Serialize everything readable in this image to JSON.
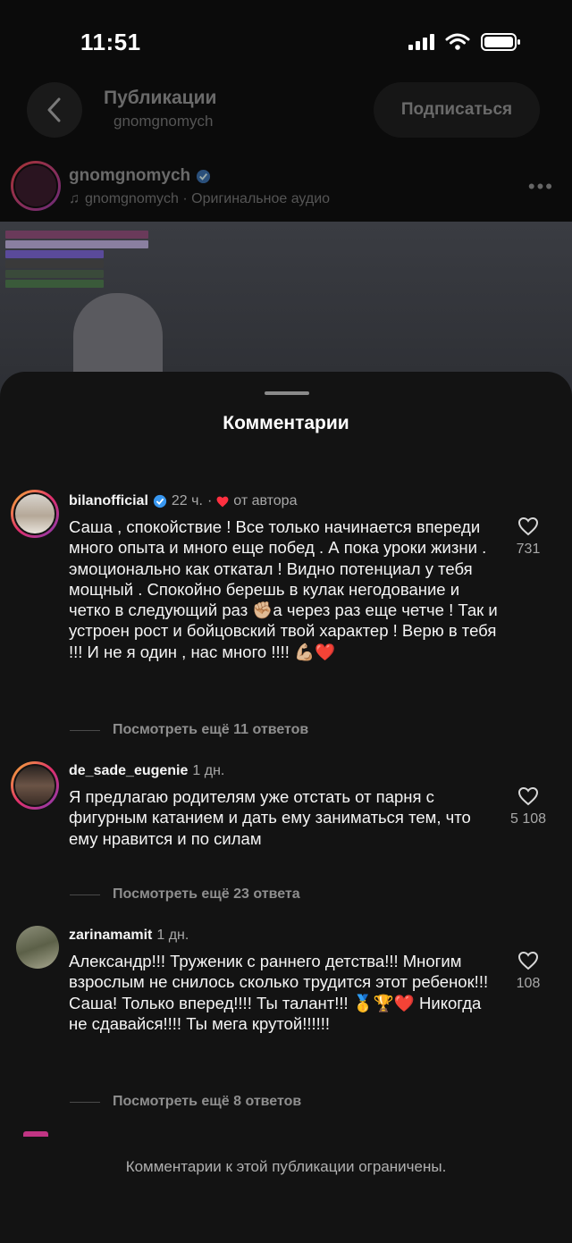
{
  "status_bar": {
    "time": "11:51"
  },
  "header": {
    "title": "Публикации",
    "subtitle": "gnomgnomych",
    "subscribe_label": "Подписаться"
  },
  "post": {
    "username": "gnomgnomych",
    "audio": "gnomgnomych · Оригинальное аудио"
  },
  "sheet": {
    "title": "Комментарии",
    "comments": [
      {
        "username": "bilanofficial",
        "time": "22 ч.",
        "author_like": "от автора",
        "text": "Саша , спокойствие ! Все только начинается впереди много опыта и много еще побед . А пока уроки  жизни . эмоционально как откатал ! Видно потенциал у тебя мощный . Спокойно берешь в кулак негодование и четко в следующий раз ✊🏼а через раз еще четче ! Так и устроен  рост и бойцовский твой характер ! Верю в тебя !!! И не я один , нас много !!!! 💪🏼❤️",
        "likes": "731",
        "replies": "Посмотреть ещё 11 ответов"
      },
      {
        "username": "de_sade_eugenie",
        "time": "1 дн.",
        "text": "Я предлагаю родителям уже отстать от парня с фигурным катанием и дать ему заниматься тем, что ему нравится и по силам",
        "likes": "5 108",
        "replies": "Посмотреть ещё 23 ответа"
      },
      {
        "username": "zarinamamit",
        "time": "1 дн.",
        "text": "Александр!!! Труженик с раннего детства!!! Многим взрослым не снилось сколько трудится этот ребенок!!! Саша! Только вперед!!!! Ты талант!!! 🥇🏆❤️ Никогда не сдавайся!!!! Ты мега крутой!!!!!!",
        "likes": "108",
        "replies": "Посмотреть ещё 8 ответов"
      }
    ],
    "restricted_notice": "Комментарии к этой публикации ограничены."
  },
  "colors": {
    "verified": "#3897f0",
    "heart_red": "#ff3040",
    "sheet_bg": "#131313"
  }
}
